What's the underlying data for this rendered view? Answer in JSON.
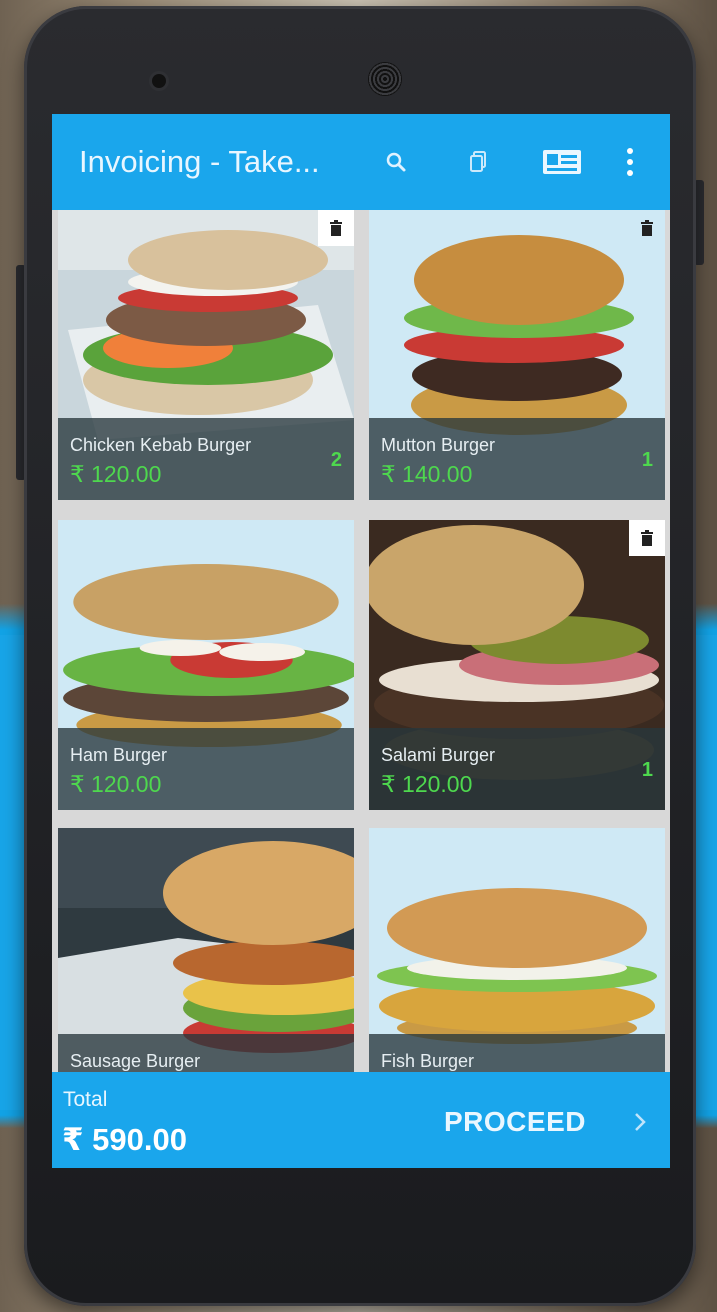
{
  "appbar": {
    "title": "Invoicing - Take...",
    "actions": [
      "search-icon",
      "copy-icon",
      "card-icon",
      "more-vert-icon"
    ]
  },
  "items": [
    {
      "name": "Chicken Kebab Burger",
      "price": "₹ 120.00",
      "qty": "2",
      "has_delete": true
    },
    {
      "name": "Mutton Burger",
      "price": "₹ 140.00",
      "qty": "1",
      "has_delete": true
    },
    {
      "name": "Ham Burger",
      "price": "₹ 120.00",
      "qty": "",
      "has_delete": false
    },
    {
      "name": "Salami Burger",
      "price": "₹ 120.00",
      "qty": "1",
      "has_delete": true
    },
    {
      "name": "Sausage Burger",
      "price": "",
      "qty": "",
      "has_delete": false
    },
    {
      "name": "Fish Burger",
      "price": "",
      "qty": "",
      "has_delete": false
    }
  ],
  "footer": {
    "total_label": "Total",
    "total_value": "₹ 590.00",
    "proceed_label": "PROCEED"
  },
  "colors": {
    "primary": "#1aa6ec",
    "price_green": "#4ed84e"
  }
}
